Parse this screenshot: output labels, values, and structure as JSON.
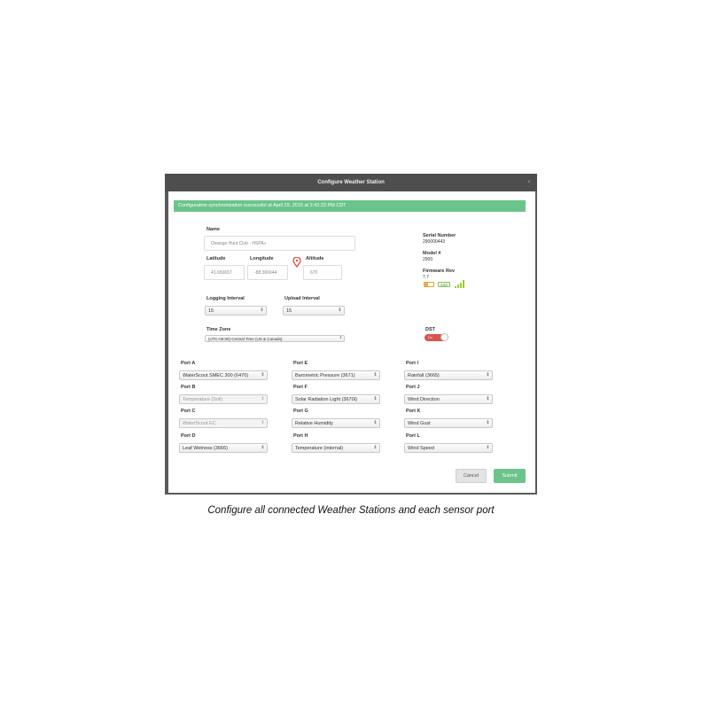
{
  "dialog": {
    "title": "Configure Weather Station",
    "close": "×",
    "banner": "Configuration synchronization successful at April 29, 2015 at 2:42:23 PM CDT"
  },
  "station": {
    "name_label": "Name",
    "name_value": "Oswego Hunt Club - HSPA+",
    "latitude_label": "Latitude",
    "latitude_value": "41.650657",
    "longitude_label": "Longitude",
    "longitude_value": "-88.366644",
    "altitude_label": "Altitude",
    "altitude_value": "670",
    "logging_label": "Logging Interval",
    "logging_value": "15",
    "upload_label": "Upload Interval",
    "upload_value": "15",
    "timezone_label": "Time Zone",
    "timezone_value": "(UTC-06:00) Central Time (US & Canada)"
  },
  "info": {
    "serial_label": "Serial Number",
    "serial_value": "290000443",
    "model_label": "Model #",
    "model_value": "2900",
    "firmware_label": "Firmware Rev",
    "firmware_value": "7.7",
    "signal_tag": "3.0G",
    "dst_label": "DST",
    "dst_state": "On"
  },
  "ports": [
    {
      "label": "Port A",
      "value": "WaterScout SMEC 300 (6470)",
      "disabled": false
    },
    {
      "label": "Port B",
      "value": "Temperature (Soil)",
      "disabled": true
    },
    {
      "label": "Port C",
      "value": "WaterScout EC",
      "disabled": true
    },
    {
      "label": "Port D",
      "value": "Leaf Wetness (3666)",
      "disabled": false
    },
    {
      "label": "Port E",
      "value": "Barometric Pressure (3671)",
      "disabled": false
    },
    {
      "label": "Port F",
      "value": "Solar Radiation Light (3670I)",
      "disabled": false
    },
    {
      "label": "Port G",
      "value": "Relative Humidity",
      "disabled": false
    },
    {
      "label": "Port H",
      "value": "Temperature (internal)",
      "disabled": false
    },
    {
      "label": "Port I",
      "value": "Rainfall (3665)",
      "disabled": false
    },
    {
      "label": "Port J",
      "value": "Wind Direction",
      "disabled": false
    },
    {
      "label": "Port K",
      "value": "Wind Gust",
      "disabled": false
    },
    {
      "label": "Port L",
      "value": "Wind Speed",
      "disabled": false
    }
  ],
  "buttons": {
    "cancel": "Cancel",
    "submit": "Submit"
  },
  "caption": "Configure all connected Weather Stations and each sensor port",
  "colors": {
    "accent": "#6bc48b",
    "dst_on": "#d9534f",
    "pin": "#d9534f"
  },
  "icons": {
    "location": "map-pin-icon",
    "battery": "battery-icon",
    "signal": "signal-strength-icon",
    "select_arrow": "up-down-arrow-icon"
  }
}
